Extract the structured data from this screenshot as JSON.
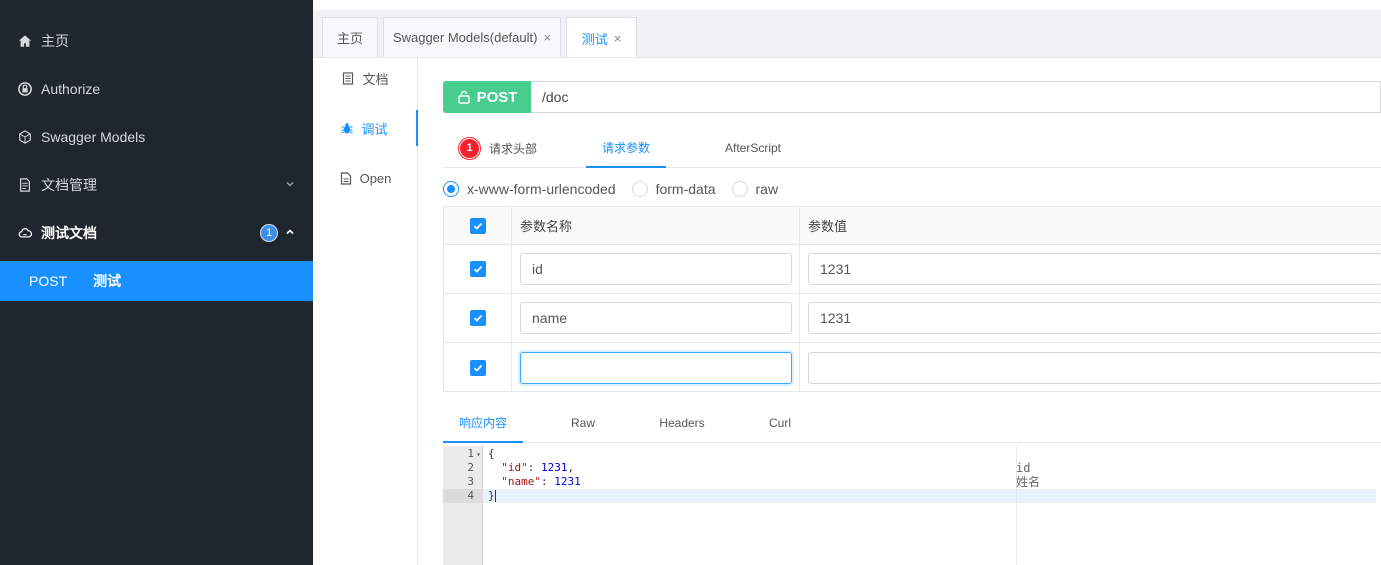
{
  "sidebar": {
    "items": [
      {
        "label": "主页",
        "icon": "home-icon"
      },
      {
        "label": "Authorize",
        "icon": "lock-icon"
      },
      {
        "label": "Swagger Models",
        "icon": "cube-icon"
      },
      {
        "label": "文档管理",
        "icon": "doc-manage-icon"
      },
      {
        "label": "测试文档",
        "icon": "cloud-icon",
        "badge": "1"
      }
    ],
    "sub_item": {
      "method": "POST",
      "label": "测试"
    }
  },
  "tabs": [
    {
      "label": "主页"
    },
    {
      "label": "Swagger Models(default)",
      "close": "×"
    },
    {
      "label": "测试",
      "close": "×"
    }
  ],
  "vnav": [
    {
      "label": "文档",
      "icon": "document-icon"
    },
    {
      "label": "调试",
      "icon": "bug-icon"
    },
    {
      "label": "Open",
      "icon": "file-icon"
    }
  ],
  "request": {
    "method": "POST",
    "url": "/doc",
    "tabs": [
      {
        "label": "请求头部",
        "badge": "1"
      },
      {
        "label": "请求参数"
      },
      {
        "label": "AfterScript"
      }
    ],
    "content_types": [
      "x-www-form-urlencoded",
      "form-data",
      "raw"
    ],
    "selected_content_type": "x-www-form-urlencoded",
    "params_header": {
      "name": "参数名称",
      "value": "参数值"
    },
    "params": [
      {
        "name": "id",
        "value": "1231"
      },
      {
        "name": "name",
        "value": "1231"
      },
      {
        "name": "",
        "value": ""
      }
    ]
  },
  "response": {
    "tabs": [
      "响应内容",
      "Raw",
      "Headers",
      "Curl"
    ],
    "line_numbers": [
      "1",
      "2",
      "3",
      "4"
    ],
    "code": {
      "l1": "{",
      "l2_key": "\"id\"",
      "l2_sep": ": ",
      "l2_val": "1231",
      "l2_end": ",",
      "l3_key": "\"name\"",
      "l3_sep": ": ",
      "l3_val": "1231",
      "l4": "}"
    },
    "comments": [
      "id",
      "姓名"
    ]
  },
  "colors": {
    "accent": "#1890ff",
    "post": "#49cc90",
    "sidebar": "#20262d",
    "badge_red": "#f5222d"
  }
}
